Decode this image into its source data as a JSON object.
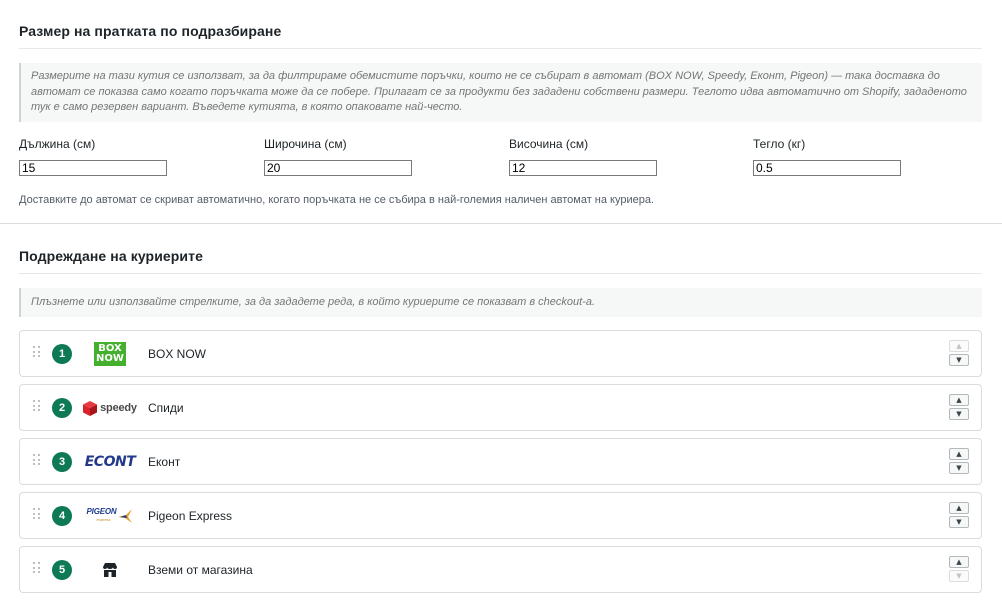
{
  "parcel_section": {
    "title": "Размер на пратката по подразбиране",
    "notice": "Размерите на тази кутия се използват, за да филтрираме обемистите поръчки, които не се събират в автомат (BOX NOW, Speedy, Еконт, Pigeon) — така доставка до автомат се показва само когато поръчката може да се побере. Прилагат се за продукти без зададени собствени размери. Теглото идва автоматично от Shopify, зададеното тук е само резервен вариант. Въведете кутията, в която опаковате най-често.",
    "fields": {
      "length": {
        "label": "Дължина (см)",
        "value": "15"
      },
      "width": {
        "label": "Широчина (см)",
        "value": "20"
      },
      "height": {
        "label": "Височина (см)",
        "value": "12"
      },
      "weight": {
        "label": "Тегло (кг)",
        "value": "0.5"
      }
    },
    "help": "Доставките до автомат се скриват автоматично, когато поръчката не се събира в най-големия наличен автомат на куриера."
  },
  "courier_section": {
    "title": "Подреждане на куриерите",
    "notice": "Плъзнете или използвайте стрелките, за да зададете реда, в който куриерите се показват в checkout-а.",
    "couriers": [
      {
        "position": "1",
        "name": "BOX NOW",
        "logo_lines": [
          "BOX",
          "NOW"
        ],
        "logo_color": "#44b02d",
        "icon": "boxnow-logo-icon"
      },
      {
        "position": "2",
        "name": "Спиди",
        "logo_text": "speedy",
        "logo_color": "#d8232a",
        "icon": "speedy-logo-icon"
      },
      {
        "position": "3",
        "name": "Еконт",
        "logo_text": "ECONT",
        "logo_color": "#233a8a",
        "icon": "econt-logo-icon"
      },
      {
        "position": "4",
        "name": "Pigeon Express",
        "logo_text": "PIGEON",
        "logo_sub": "express",
        "logo_color": "#1f3d8c",
        "icon": "pigeon-logo-icon"
      },
      {
        "position": "5",
        "name": "Вземи от магазина",
        "icon": "store-icon"
      }
    ],
    "move_up_glyph": "▲",
    "move_down_glyph": "▼"
  },
  "colors": {
    "badge": "#0e7a55",
    "boxnow": "#44b02d",
    "speedy": "#d8232a",
    "econt": "#233a8a",
    "pigeon": "#1f3d8c"
  }
}
